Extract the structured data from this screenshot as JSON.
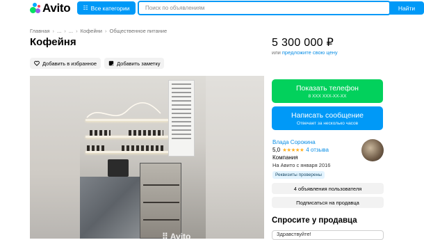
{
  "header": {
    "logo_text": "Avito",
    "categories_label": "Все категории",
    "search_placeholder": "Поиск по объявлениям",
    "search_button": "Найти"
  },
  "breadcrumbs": [
    "Главная",
    "...",
    "...",
    "Кофейни",
    "Общественное питание"
  ],
  "listing": {
    "title": "Кофейня",
    "favorite_label": "Добавить в избранное",
    "note_label": "Добавить заметку",
    "photo_watermark": "Avito"
  },
  "price": {
    "value": "5 300 000 ₽",
    "or_text": "или",
    "suggest_link": "предложите свою цену"
  },
  "actions": {
    "phone_label": "Показать телефон",
    "phone_sub": "8 XXX XXX-XX-XX",
    "message_label": "Написать сообщение",
    "message_sub": "Отвечает за несколько часов"
  },
  "seller": {
    "name": "Влада Сорокина",
    "rating": "5,0",
    "stars": "★★★★★",
    "reviews": "4 отзыва",
    "type": "Компания",
    "since": "На Авито с января 2016",
    "verified_badge": "Реквизиты проверены",
    "listings_button": "4 объявления пользователя",
    "subscribe_button": "Подписаться на продавца"
  },
  "ask": {
    "title": "Спросите у продавца",
    "input_value": "Здравствуйте!"
  },
  "colors": {
    "accent_blue": "#0099f7",
    "phone_green": "#02d15c",
    "link_blue": "#0a8ee5",
    "star": "#ffb021"
  }
}
